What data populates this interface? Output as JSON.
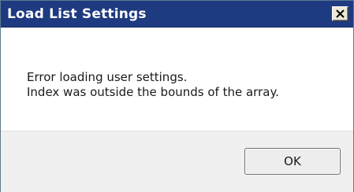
{
  "dialog": {
    "title": "Load List Settings",
    "close_icon": "close-icon",
    "message_lines": [
      "Error loading user settings.",
      "Index was outside the bounds of the array."
    ],
    "ok_label": "OK"
  },
  "colors": {
    "titlebar": "#1e3a80",
    "title_text": "#ffffff",
    "content_bg": "#ffffff",
    "footer_bg": "#f0f0f0"
  }
}
